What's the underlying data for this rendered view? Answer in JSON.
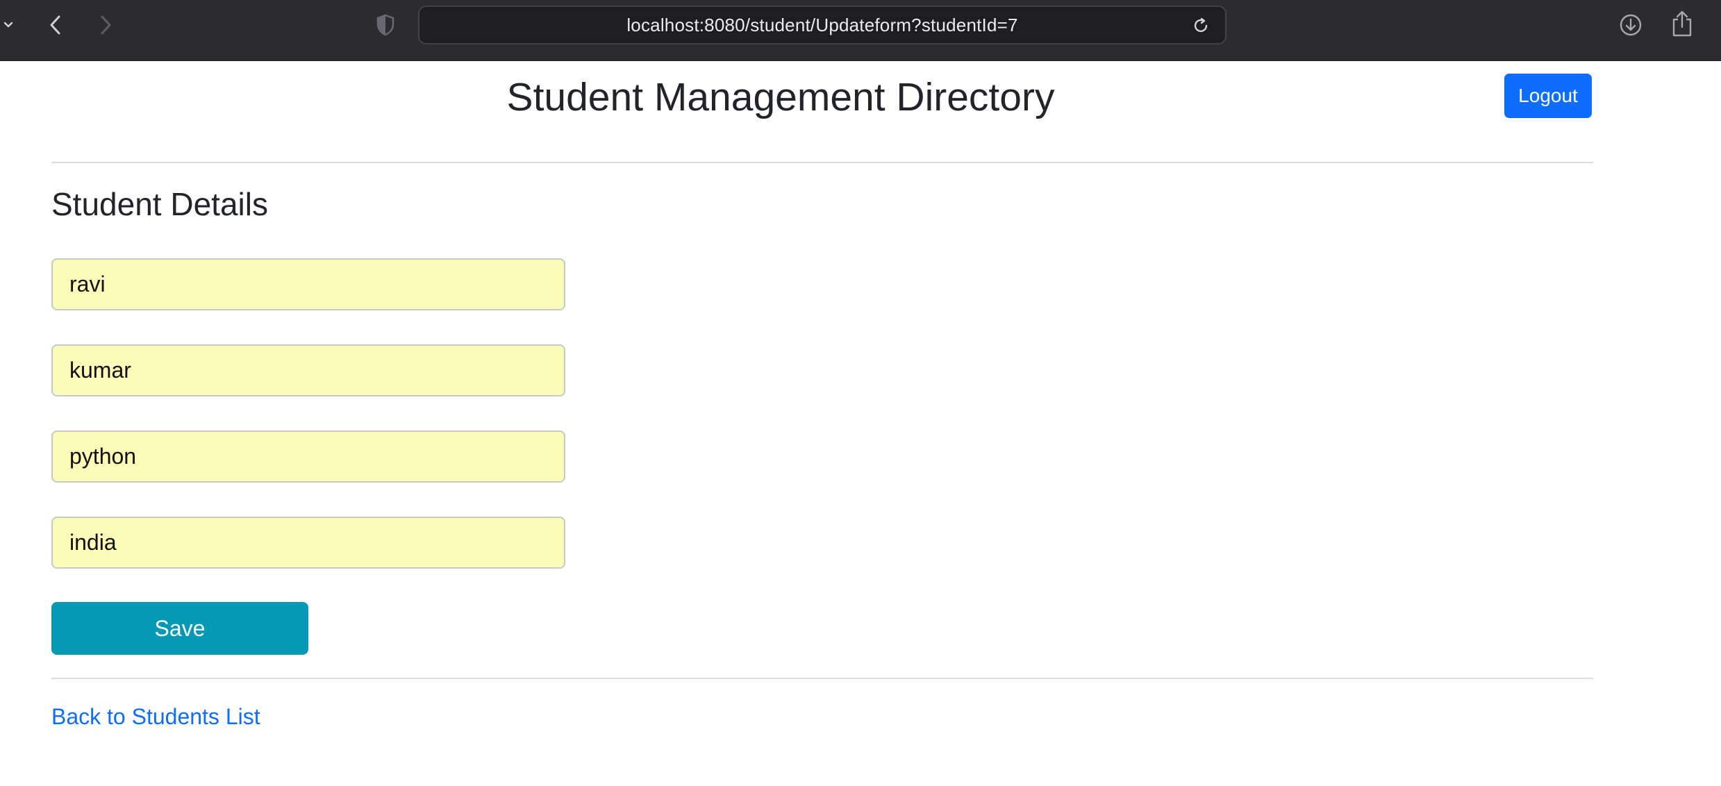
{
  "browser": {
    "url": "localhost:8080/student/Updateform?studentId=7",
    "icons": {
      "tab_overview": "chevron-down-icon",
      "back": "chevron-left-icon",
      "forward": "chevron-right-icon",
      "privacy": "shield-icon",
      "reload": "reload-icon",
      "downloads": "download-icon",
      "share": "share-icon"
    },
    "colors": {
      "toolbar": "#2c2b30",
      "address_bar": "#1e1d22"
    }
  },
  "header": {
    "title": "Student Management Directory",
    "logout_label": "Logout"
  },
  "form": {
    "section_title": "Student Details",
    "fields": [
      {
        "value": "ravi"
      },
      {
        "value": "kumar"
      },
      {
        "value": "python"
      },
      {
        "value": "india"
      }
    ],
    "save_label": "Save",
    "back_link_label": "Back to Students List"
  },
  "colors": {
    "logout_button": "#0d6efd",
    "save_button": "#0399b5",
    "field_background": "#fafcb8",
    "link": "#0d6efd"
  }
}
